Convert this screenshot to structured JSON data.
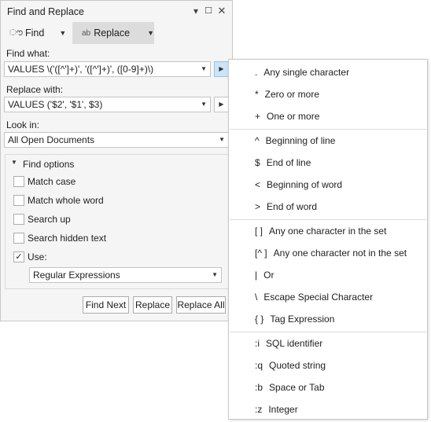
{
  "dialog": {
    "title": "Find and Replace",
    "tabs": [
      {
        "label": "Find",
        "icon": "binoculars-icon"
      },
      {
        "label": "Replace",
        "icon": "replace-icon"
      }
    ],
    "find_label": "Find what:",
    "find_value": "VALUES \\('([^']+)', '([^']+)', ([0-9]+)\\)",
    "replace_label": "Replace with:",
    "replace_value": "VALUES ('$2', '$1', $3)",
    "lookin_label": "Look in:",
    "lookin_value": "All Open Documents",
    "options_header": "Find options",
    "options": [
      {
        "label": "Match case",
        "checked": false
      },
      {
        "label": "Match whole word",
        "checked": false
      },
      {
        "label": "Search up",
        "checked": false
      },
      {
        "label": "Search hidden text",
        "checked": false
      },
      {
        "label": "Use:",
        "checked": true
      }
    ],
    "use_value": "Regular Expressions",
    "buttons": {
      "find_next": "Find Next",
      "replace": "Replace",
      "replace_all": "Replace All"
    }
  },
  "regex_menu": [
    {
      "token": ".",
      "label": "Any single character"
    },
    {
      "token": "*",
      "label": "Zero or more"
    },
    {
      "token": "+",
      "label": "One or more"
    },
    {
      "token": "^",
      "label": "Beginning of line"
    },
    {
      "token": "$",
      "label": "End of line"
    },
    {
      "token": "<",
      "label": "Beginning of word"
    },
    {
      "token": ">",
      "label": "End of word"
    },
    {
      "token": "[ ]",
      "label": "Any one character in the set"
    },
    {
      "token": "[^ ]",
      "label": "Any one character not in the set"
    },
    {
      "token": "|",
      "label": "Or"
    },
    {
      "token": "\\",
      "label": "Escape Special Character"
    },
    {
      "token": "{ }",
      "label": "Tag Expression"
    },
    {
      "token": ":i",
      "label": "SQL identifier"
    },
    {
      "token": ":q",
      "label": "Quoted string"
    },
    {
      "token": ":b",
      "label": "Space or Tab"
    },
    {
      "token": ":z",
      "label": "Integer"
    }
  ]
}
